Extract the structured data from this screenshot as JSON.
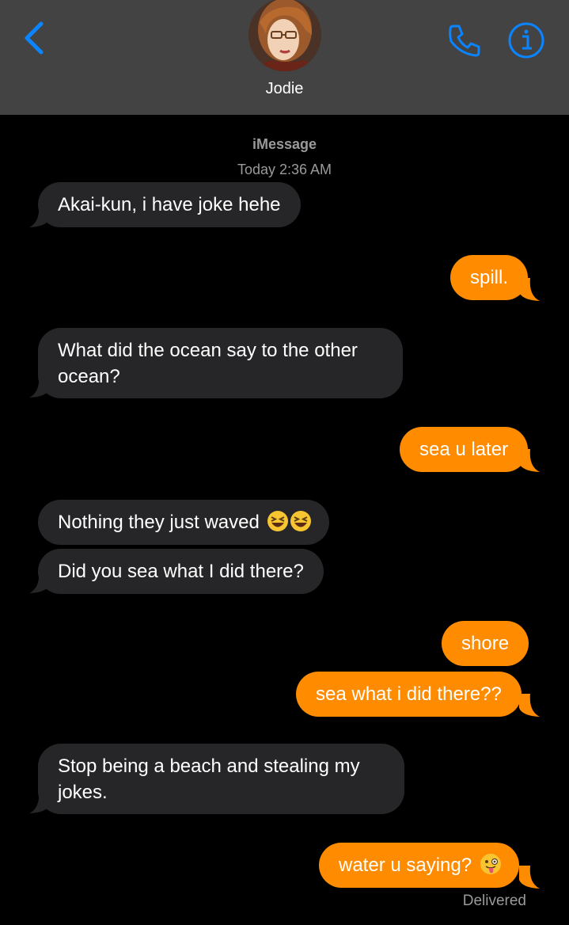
{
  "header": {
    "contact_name": "Jodie",
    "back_icon": "chevron-left-icon",
    "call_icon": "phone-icon",
    "info_icon": "info-icon"
  },
  "thread": {
    "service": "iMessage",
    "timestamp": "Today 2:36 AM",
    "status": "Delivered"
  },
  "messages": [
    {
      "direction": "incoming",
      "text": "Akai-kun, i have joke hehe"
    },
    {
      "direction": "outgoing",
      "text": "spill."
    },
    {
      "direction": "incoming",
      "text": "What did the ocean say to the other",
      "text_line2": "ocean?"
    },
    {
      "direction": "outgoing",
      "text": "sea u later"
    },
    {
      "direction": "incoming",
      "text": "Nothing they just waved",
      "emoji": "laughing-squint-emoji"
    },
    {
      "direction": "incoming",
      "text": "Did you sea what I did there?"
    },
    {
      "direction": "outgoing",
      "text": "shore"
    },
    {
      "direction": "outgoing",
      "text": "sea what i did there??"
    },
    {
      "direction": "incoming",
      "text": "Stop being a beach and stealing my",
      "text_line2": "jokes."
    },
    {
      "direction": "outgoing",
      "text": "water u saying?",
      "emoji": "winking-tongue-emoji"
    }
  ],
  "colors": {
    "header_bg": "#434343",
    "accent_blue": "#0a84ff",
    "incoming_bubble": "#262628",
    "outgoing_bubble": "#ff8c00",
    "meta_text": "#9a9a9a"
  }
}
